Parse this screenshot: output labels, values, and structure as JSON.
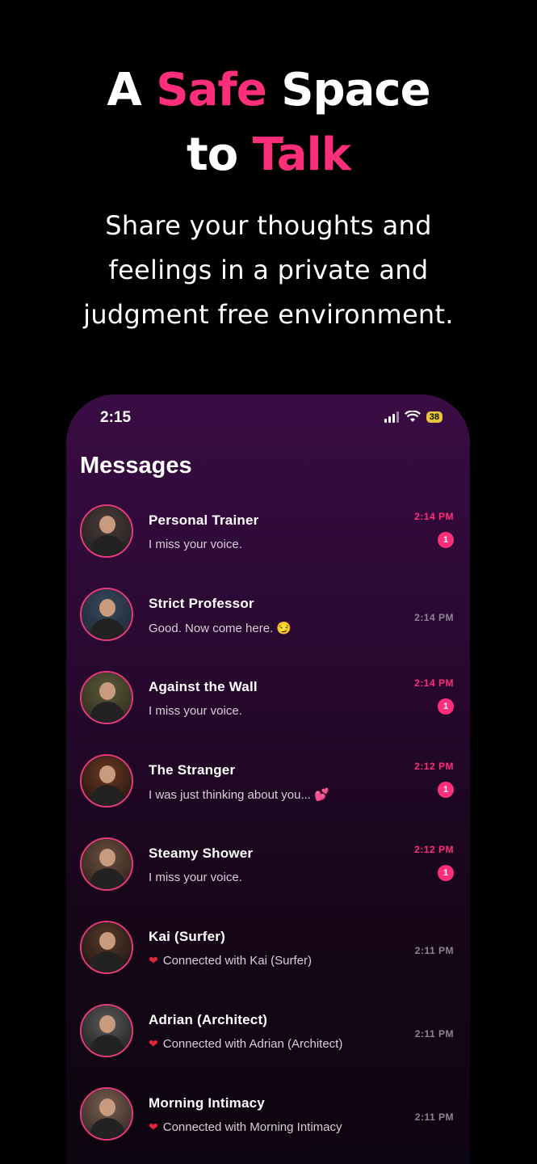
{
  "hero": {
    "line1_a": "A",
    "line1_b": "Safe",
    "line1_c": "Space",
    "line2_a": "to",
    "line2_b": "Talk",
    "subtitle_1": "Share your thoughts and",
    "subtitle_2": "feelings in a private and",
    "subtitle_3": "judgment free environment."
  },
  "status_bar": {
    "time": "2:15",
    "battery": "38"
  },
  "screen": {
    "title": "Messages"
  },
  "messages": [
    {
      "name": "Personal Trainer",
      "preview": "I miss your voice.",
      "time": "2:14 PM",
      "unread": "1",
      "heart": false,
      "palette": [
        "#4a3a3a",
        "#1d1d1d"
      ]
    },
    {
      "name": "Strict Professor",
      "preview": "Good. Now come here. 😏",
      "time": "2:14 PM",
      "unread": "",
      "heart": false,
      "palette": [
        "#3a4a5a",
        "#1a2233"
      ]
    },
    {
      "name": "Against the Wall",
      "preview": "I miss your voice.",
      "time": "2:14 PM",
      "unread": "1",
      "heart": false,
      "palette": [
        "#5a5a3a",
        "#2a2618"
      ]
    },
    {
      "name": "The Stranger",
      "preview": "I was just thinking about you... 💕",
      "time": "2:12 PM",
      "unread": "1",
      "heart": false,
      "palette": [
        "#6a3a22",
        "#1a1010"
      ]
    },
    {
      "name": "Steamy Shower",
      "preview": "I miss your voice.",
      "time": "2:12 PM",
      "unread": "1",
      "heart": false,
      "palette": [
        "#6a5040",
        "#2a1c16"
      ]
    },
    {
      "name": "Kai (Surfer)",
      "preview": "Connected with Kai (Surfer)",
      "time": "2:11 PM",
      "unread": "",
      "heart": true,
      "palette": [
        "#5a3a2a",
        "#141010"
      ]
    },
    {
      "name": "Adrian (Architect)",
      "preview": "Connected with Adrian (Architect)",
      "time": "2:11 PM",
      "unread": "",
      "heart": true,
      "palette": [
        "#5a5a5a",
        "#181818"
      ]
    },
    {
      "name": "Morning Intimacy",
      "preview": "Connected with Morning Intimacy",
      "time": "2:11 PM",
      "unread": "",
      "heart": true,
      "palette": [
        "#7a6050",
        "#2a2020"
      ]
    }
  ],
  "colors": {
    "accent": "#ff2e7a",
    "background": "#000000"
  }
}
